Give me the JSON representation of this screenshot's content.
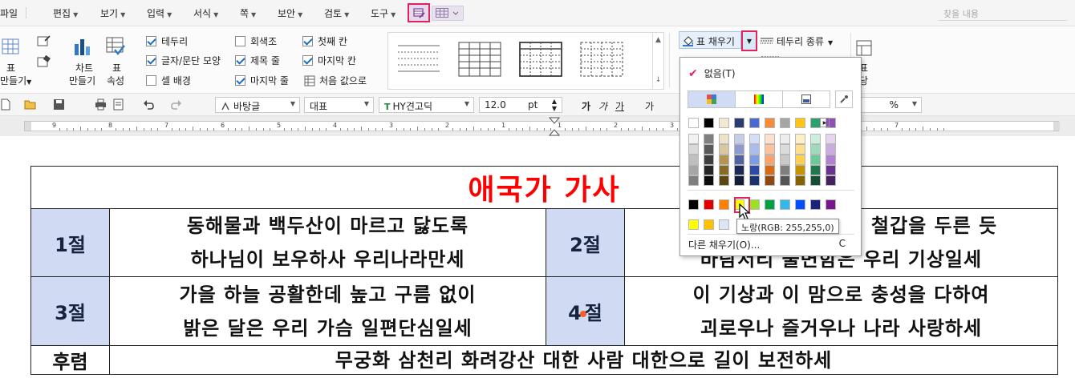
{
  "menubar": {
    "items": [
      {
        "label": "파일",
        "has_arrow": false
      },
      {
        "label": "편집",
        "has_arrow": true
      },
      {
        "label": "보기",
        "has_arrow": true
      },
      {
        "label": "입력",
        "has_arrow": true
      },
      {
        "label": "서식",
        "has_arrow": true
      },
      {
        "label": "쪽",
        "has_arrow": true
      },
      {
        "label": "보안",
        "has_arrow": true
      },
      {
        "label": "검토",
        "has_arrow": true
      },
      {
        "label": "도구",
        "has_arrow": true
      }
    ],
    "search_placeholder": "찾을 내용"
  },
  "ribbon": {
    "table_label_1": "표",
    "table_label_2": "만들기",
    "chart_label_1": "차트",
    "chart_label_2": "만들기",
    "props_label_1": "표",
    "props_label_2": "속성",
    "options": [
      {
        "label": "테두리",
        "checked": true
      },
      {
        "label": "글자/문단 모양",
        "checked": true
      },
      {
        "label": "셀 배경",
        "checked": false
      },
      {
        "label": "회색조",
        "checked": false
      },
      {
        "label": "제목 줄",
        "checked": true
      },
      {
        "label": "마지막 줄",
        "checked": true
      },
      {
        "label": "첫째 칸",
        "checked": true
      },
      {
        "label": "마지막 칸",
        "checked": true
      }
    ],
    "reset_label": "처음 값으로",
    "fill_label": "표 채우기",
    "border_kind_label": "테두리 종류",
    "right_label_1": "표",
    "right_label_2": "당"
  },
  "toolbar": {
    "style_value": "바탕글",
    "para_value": "대표",
    "font_value": "HY견고딕",
    "size_value": "12.0",
    "size_unit": "pt",
    "bold_glyph": "가",
    "italic_glyph": "가",
    "underline_glyph": "가",
    "strike_glyph": "가",
    "percent": "%"
  },
  "ruler": {
    "numbers": [
      "9",
      "8",
      "7",
      "6",
      "5",
      "4",
      "3",
      "2",
      "1",
      "1",
      "2",
      "3",
      "4",
      "5",
      "6",
      "7"
    ]
  },
  "document": {
    "title": "애국가 가사",
    "verse1_label": "1절",
    "verse1_line1": "동해물과 백두산이 마르고 닳도록",
    "verse1_line2": "하나님이 보우하사 우리나라만세",
    "verse2_label": "2절",
    "verse2_line1": "남산 위에 저 소나무, 철갑을 두른 듯",
    "verse2_line2": "바람서리 불변함은 우리 기상일세",
    "verse3_label": "3절",
    "verse3_line1": "가을 하늘 공활한데 높고 구름 없이",
    "verse3_line2": "밝은 달은 우리 가슴 일편단심일세",
    "verse4_label_a": "4",
    "verse4_label_b": "절",
    "verse4_line1": "이 기상과 이 맘으로 충성을 다하여",
    "verse4_line2": "괴로우나 즐거우나 나라 사랑하세",
    "refrain_label": "후렴",
    "refrain_text": "무궁화 삼천리 화려강산 대한 사람 대한으로 길이 보전하세"
  },
  "palette": {
    "none_label": "없음(T)",
    "more_label": "다른 채우기(O)...",
    "more_accel": "C",
    "tooltip": "노랑(RGB: 255,255,0)",
    "selected_color": "#ffff00",
    "top_row": [
      "#ffffff",
      "#000000",
      "#f2e7d3",
      "#2c3a73",
      "#4a6ad0",
      "#f58c3a",
      "#a6a6a6",
      "#ffc515",
      "#2ea06a",
      "#8f4fb5"
    ],
    "shade_rows": [
      [
        "#f2f2f2",
        "#7f7f7f",
        "#ece2c8",
        "#c6cde7",
        "#d4def6",
        "#fde0cd",
        "#ededed",
        "#ffefc4",
        "#cdeedc",
        "#e5d5f0"
      ],
      [
        "#d9d9d9",
        "#595959",
        "#d9c7a0",
        "#8d9ad0",
        "#a9bdee",
        "#fbc29c",
        "#dbdbdb",
        "#ffe08a",
        "#9cdcb9",
        "#ccabe1"
      ],
      [
        "#bfbfbf",
        "#3f3f3f",
        "#b3954f",
        "#53639f",
        "#7d9ce6",
        "#f9a36b",
        "#c9c9c9",
        "#ffd14f",
        "#6acb96",
        "#b281d2"
      ],
      [
        "#a6a6a6",
        "#262626",
        "#8a6b25",
        "#1e2a56",
        "#2b4ba6",
        "#d96b14",
        "#7f7f7f",
        "#c79400",
        "#1f774e",
        "#6b3390"
      ],
      [
        "#7f7f7f",
        "#0d0d0d",
        "#5c4711",
        "#141c39",
        "#1c326f",
        "#91470d",
        "#555555",
        "#846200",
        "#144f34",
        "#472260"
      ]
    ],
    "standard_row": [
      "#000000",
      "#e00000",
      "#ff7f00",
      "#ffff00",
      "#9be026",
      "#00a040",
      "#35b8e8",
      "#0050ff",
      "#1a237a",
      "#7a1590"
    ],
    "recent_row": [
      "#ffff00",
      "#ffc000",
      "#dde4f5"
    ]
  }
}
